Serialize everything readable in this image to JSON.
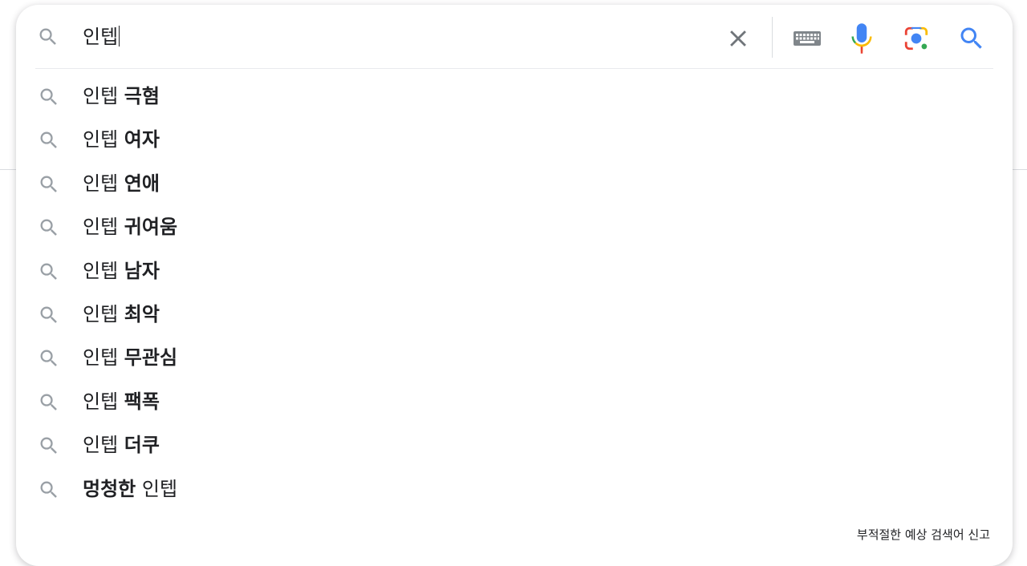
{
  "search": {
    "query": "인텝",
    "clear_icon": "close-icon",
    "keyboard_icon": "keyboard-icon",
    "mic_icon": "microphone-icon",
    "lens_icon": "camera-lens-icon",
    "submit_icon": "search-icon"
  },
  "suggestions": [
    {
      "prefix": "인텝 ",
      "bold": "극혐",
      "suffix": ""
    },
    {
      "prefix": "인텝 ",
      "bold": "여자",
      "suffix": ""
    },
    {
      "prefix": "인텝 ",
      "bold": "연애",
      "suffix": ""
    },
    {
      "prefix": "인텝 ",
      "bold": "귀여움",
      "suffix": ""
    },
    {
      "prefix": "인텝 ",
      "bold": "남자",
      "suffix": ""
    },
    {
      "prefix": "인텝 ",
      "bold": "최악",
      "suffix": ""
    },
    {
      "prefix": "인텝 ",
      "bold": "무관심",
      "suffix": ""
    },
    {
      "prefix": "인텝 ",
      "bold": "팩폭",
      "suffix": ""
    },
    {
      "prefix": "인텝 ",
      "bold": "더쿠",
      "suffix": ""
    },
    {
      "prefix": "",
      "bold": "멍청한",
      "suffix": " 인텝"
    }
  ],
  "footer": {
    "report_label": "부적절한 예상 검색어 신고"
  },
  "colors": {
    "icon_gray": "#9aa0a6",
    "clear_gray": "#70757a",
    "google_blue": "#4285f4",
    "google_red": "#ea4335",
    "google_yellow": "#fbbc04",
    "google_green": "#34a853",
    "text": "#202124"
  }
}
